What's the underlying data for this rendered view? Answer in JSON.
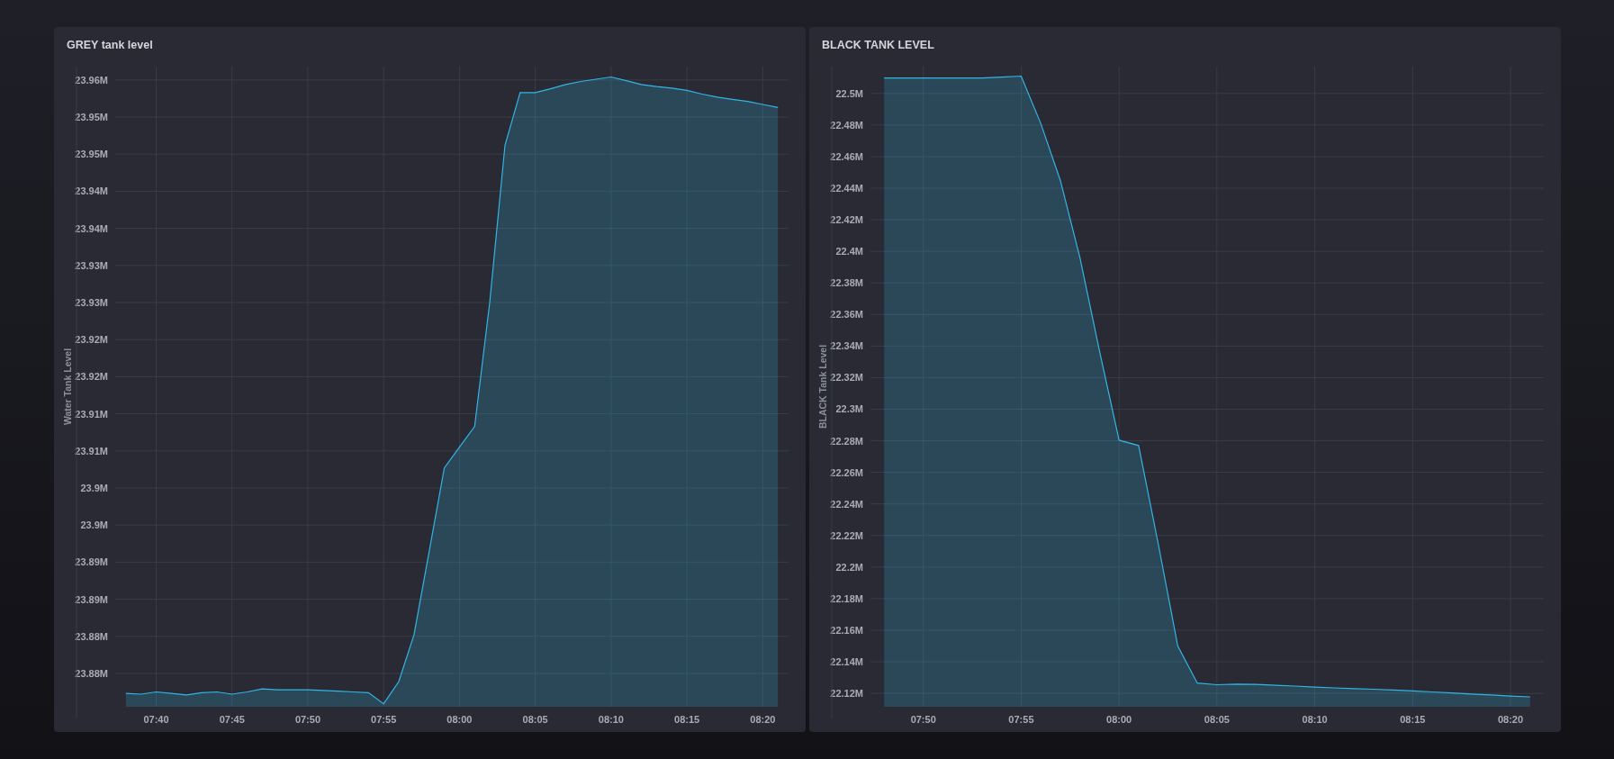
{
  "panels": [
    {
      "title": "GREY tank level",
      "chart_data": {
        "type": "area",
        "ylabel": "Water Tank Level",
        "ylim": [
          23.8755,
          23.9618
        ],
        "grid": true,
        "categories": [
          null,
          null,
          "07:40",
          null,
          null,
          null,
          null,
          "07:45",
          null,
          null,
          null,
          null,
          "07:50",
          null,
          null,
          null,
          null,
          "07:55",
          null,
          null,
          null,
          null,
          "08:00",
          null,
          null,
          null,
          null,
          "08:05",
          null,
          null,
          null,
          null,
          "08:10",
          null,
          null,
          null,
          null,
          "08:15",
          null,
          null,
          null,
          null,
          "08:20",
          null
        ],
        "yticks": [
          {
            "value": 23.96,
            "label": "23.96M"
          },
          {
            "value": 23.955,
            "label": "23.95M"
          },
          {
            "value": 23.95,
            "label": "23.95M"
          },
          {
            "value": 23.945,
            "label": "23.94M"
          },
          {
            "value": 23.94,
            "label": "23.94M"
          },
          {
            "value": 23.935,
            "label": "23.93M"
          },
          {
            "value": 23.93,
            "label": "23.93M"
          },
          {
            "value": 23.925,
            "label": "23.92M"
          },
          {
            "value": 23.92,
            "label": "23.92M"
          },
          {
            "value": 23.915,
            "label": "23.91M"
          },
          {
            "value": 23.91,
            "label": "23.91M"
          },
          {
            "value": 23.905,
            "label": "23.9M"
          },
          {
            "value": 23.9,
            "label": "23.9M"
          },
          {
            "value": 23.895,
            "label": "23.89M"
          },
          {
            "value": 23.89,
            "label": "23.89M"
          },
          {
            "value": 23.885,
            "label": "23.88M"
          },
          {
            "value": 23.88,
            "label": "23.88M"
          }
        ],
        "series": [
          {
            "color": "#33b5e5",
            "values": [
              23.8773,
              23.8772,
              23.8775,
              23.8773,
              23.8771,
              23.8774,
              23.8775,
              23.8772,
              23.8775,
              23.8779,
              23.8778,
              23.8778,
              23.8778,
              23.8777,
              23.8776,
              23.8775,
              23.8774,
              23.8759,
              23.8789,
              23.8852,
              23.8964,
              23.9077,
              23.9105,
              23.9133,
              23.9301,
              23.9512,
              23.9583,
              23.9583,
              23.9588,
              23.9594,
              23.9598,
              23.9601,
              23.9604,
              23.9599,
              23.9594,
              23.9591,
              23.9589,
              23.9586,
              23.9581,
              23.9577,
              23.9574,
              23.9571,
              23.9567,
              23.9563
            ]
          }
        ]
      }
    },
    {
      "title": "BLACK TANK LEVEL",
      "chart_data": {
        "type": "area",
        "ylabel": "BLACK Tank Level",
        "ylim": [
          22.1115,
          22.517
        ],
        "grid": true,
        "categories": [
          null,
          null,
          "07:50",
          null,
          null,
          null,
          null,
          "07:55",
          null,
          null,
          null,
          null,
          "08:00",
          null,
          null,
          null,
          null,
          "08:05",
          null,
          null,
          null,
          null,
          "08:10",
          null,
          null,
          null,
          null,
          "08:15",
          null,
          null,
          null,
          null,
          "08:20",
          null
        ],
        "yticks": [
          {
            "value": 22.5,
            "label": "22.5M"
          },
          {
            "value": 22.48,
            "label": "22.48M"
          },
          {
            "value": 22.46,
            "label": "22.46M"
          },
          {
            "value": 22.44,
            "label": "22.44M"
          },
          {
            "value": 22.42,
            "label": "22.42M"
          },
          {
            "value": 22.4,
            "label": "22.4M"
          },
          {
            "value": 22.38,
            "label": "22.38M"
          },
          {
            "value": 22.36,
            "label": "22.36M"
          },
          {
            "value": 22.34,
            "label": "22.34M"
          },
          {
            "value": 22.32,
            "label": "22.32M"
          },
          {
            "value": 22.3,
            "label": "22.3M"
          },
          {
            "value": 22.28,
            "label": "22.28M"
          },
          {
            "value": 22.26,
            "label": "22.26M"
          },
          {
            "value": 22.24,
            "label": "22.24M"
          },
          {
            "value": 22.22,
            "label": "22.22M"
          },
          {
            "value": 22.2,
            "label": "22.2M"
          },
          {
            "value": 22.18,
            "label": "22.18M"
          },
          {
            "value": 22.16,
            "label": "22.16M"
          },
          {
            "value": 22.14,
            "label": "22.14M"
          },
          {
            "value": 22.12,
            "label": "22.12M"
          }
        ],
        "series": [
          {
            "color": "#33b5e5",
            "values": [
              22.5098,
              22.5098,
              22.5098,
              22.5098,
              22.5098,
              22.5098,
              22.5104,
              22.511,
              22.481,
              22.445,
              22.396,
              22.337,
              22.2804,
              22.277,
              22.215,
              22.15,
              22.1265,
              22.1255,
              22.1258,
              22.1257,
              22.1251,
              22.1246,
              22.124,
              22.1235,
              22.123,
              22.1226,
              22.1221,
              22.1216,
              22.1209,
              22.1203,
              22.1196,
              22.119,
              22.1183,
              22.1178
            ]
          }
        ]
      }
    }
  ]
}
